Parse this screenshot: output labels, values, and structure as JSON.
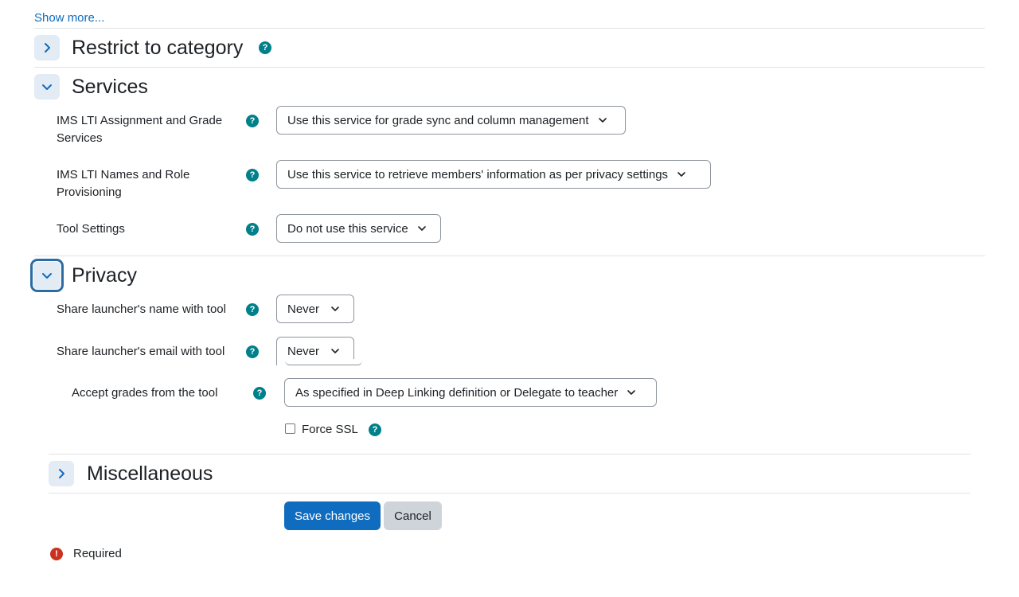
{
  "show_more": "Show more...",
  "sections": {
    "restrict": {
      "title": "Restrict to category"
    },
    "services": {
      "title": "Services",
      "ags_label": "IMS LTI Assignment and Grade Services",
      "ags_value": "Use this service for grade sync and column management",
      "nrps_label": "IMS LTI Names and Role Provisioning",
      "nrps_value": "Use this service to retrieve members' information as per privacy settings",
      "tool_settings_label": "Tool Settings",
      "tool_settings_value": "Do not use this service"
    },
    "privacy": {
      "title": "Privacy",
      "share_name_label": "Share launcher's name with tool",
      "share_name_value": "Never",
      "share_email_label": "Share launcher's email with tool",
      "share_email_value": "Never",
      "accept_grades_label": "Accept grades from the tool",
      "accept_grades_value": "As specified in Deep Linking definition or Delegate to teacher",
      "force_ssl_label": "Force SSL"
    },
    "misc": {
      "title": "Miscellaneous"
    }
  },
  "buttons": {
    "save": "Save changes",
    "cancel": "Cancel"
  },
  "required_note": "Required",
  "help_glyph": "?",
  "required_glyph": "!",
  "colors": {
    "link": "#0f6cbf",
    "primary": "#0f6cbf",
    "help": "#00808a",
    "required": "#ca3120",
    "toggle_bg": "#e3ebf5"
  }
}
